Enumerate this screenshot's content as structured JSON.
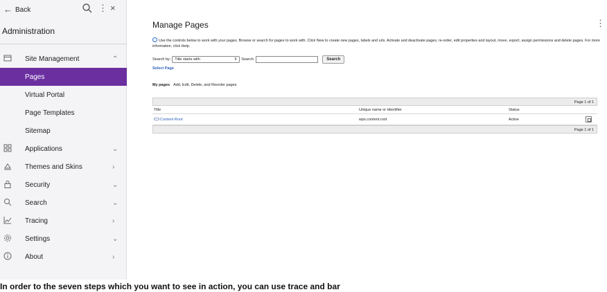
{
  "sidebar": {
    "back_label": "Back",
    "title": "Administration",
    "items": [
      {
        "label": "Site Management",
        "icon": "site-management-icon",
        "chevron": "^"
      },
      {
        "label": "Pages"
      },
      {
        "label": "Virtual Portal"
      },
      {
        "label": "Page Templates"
      },
      {
        "label": "Sitemap"
      },
      {
        "label": "Applications",
        "icon": "applications-icon",
        "chevron": "v"
      },
      {
        "label": "Themes and Skins",
        "icon": "themes-icon",
        "chevron": ">"
      },
      {
        "label": "Security",
        "icon": "lock-icon",
        "chevron": "v"
      },
      {
        "label": "Search",
        "icon": "search-icon",
        "chevron": "v"
      },
      {
        "label": "Tracing",
        "icon": "chart-icon",
        "chevron": ">"
      },
      {
        "label": "Settings",
        "icon": "gear-icon",
        "chevron": "v"
      },
      {
        "label": "About",
        "icon": "info-icon",
        "chevron": ">"
      }
    ],
    "active_color": "#6b2fa0"
  },
  "main": {
    "title": "Manage Pages",
    "help_text": "Use the controls below to work with your pages. Browse or search for pages to work with. Click New to create new pages, labels and urls. Activate and deactivate pages, re-order, edit properties and layout, move, export, assign permissions and delete pages. For more information, click Help.",
    "search_by_label": "Search by:",
    "search_by_value": "Title starts with",
    "search_label": "Search:",
    "search_value": "",
    "search_button": "Search",
    "select_page": "Select Page",
    "my_pages_label": "My pages",
    "my_pages_desc": "Add, Edit, Delete, and Reorder pages",
    "pager_top": "Page 1 of 1",
    "pager_bottom": "Page 1 of 1",
    "columns": {
      "title": "Title",
      "uid": "Unique name or Identifier",
      "status": "Status"
    },
    "rows": [
      {
        "title": "Content Root",
        "uid": "wps.content.root",
        "status": "Active"
      }
    ]
  },
  "caption": "In order to the seven steps which you want to see in action, you can use trace and bar"
}
